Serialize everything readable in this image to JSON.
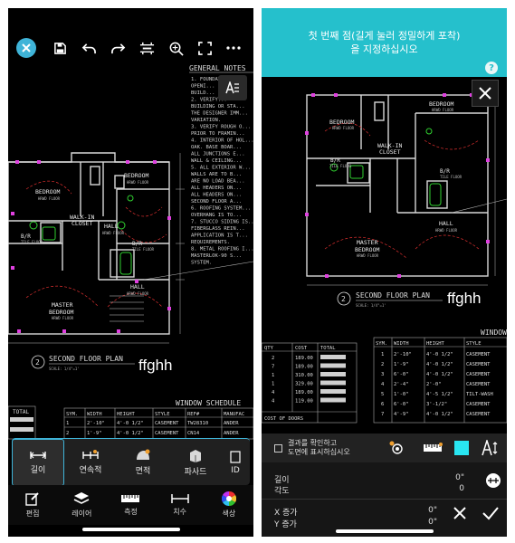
{
  "left": {
    "annotation_text": "ffghh",
    "notes_title": "GENERAL NOTES",
    "notes_lines": [
      "1. FOUNDATION...",
      "OPENI...",
      "BUILD...",
      "2. VERIFY...",
      "BUILDING OR STA...",
      "THE DESIGNER IMM...",
      "VARIATION.",
      "3. VERIFY ROUGH O...",
      "PRIOR TO FRAMIN...",
      "4. INTERIOR OF HOL...",
      "OAK. BASE BOAR...",
      "ALL JUNCTIONS E...",
      "WALL & CEILING...",
      "5. ALL EXTERIOR W...",
      "WALLS ARE TO B...",
      "ARE NO LOAD BEA...",
      "ALL HEADERS ON...",
      "ALL HEADERS ON...",
      "SECOND FLOOR A...",
      "6. ROOFING SYSTEM...",
      "OVERHANG IS TO...",
      "7. STUCCO SIDING IS...",
      "FIBERGLASS REIN...",
      "APPLICATION IS T...",
      "REQUIREMENTS.",
      "8. METAL ROOFING I...",
      "MASTERLOK-90 S...",
      "SYSTEM."
    ],
    "rooms": [
      {
        "name": "BEDROOM",
        "sub": "HRWD FLOOR"
      },
      {
        "name": "BEDROOM",
        "sub": "HRWD FLOOR"
      },
      {
        "name": "WALK-IN",
        "sub": "CLOSET"
      },
      {
        "name": "HALL",
        "sub": "HRWD FLOOR"
      },
      {
        "name": "B/R",
        "sub": "TILE FLOOR"
      },
      {
        "name": "B/R",
        "sub": "TILE FLOOR"
      },
      {
        "name": "HALL",
        "sub": "HRWD FLOOR"
      },
      {
        "name": "MASTER",
        "sub": "BEDROOM"
      },
      {
        "name": "HRWD FLOOR",
        "sub": ""
      }
    ],
    "plan_number": "2",
    "plan_title": "SECOND FLOOR PLAN",
    "plan_scale": "SCALE: 1/4\"=1'",
    "schedule_title": "WINDOW SCHEDULE",
    "schedule_headers": [
      "SYM.",
      "WIDTH",
      "HEIGHT",
      "STYLE",
      "REF#",
      "MANUFAC"
    ],
    "schedule_rows": [
      [
        "1",
        "2'-10\"",
        "4'-0 1/2\"",
        "CASEMENT",
        "TW28310",
        "ANDER"
      ],
      [
        "2",
        "1'-9\"",
        "4'-0 1/2\"",
        "CASEMENT",
        "CN14",
        "ANDER"
      ]
    ],
    "total_label": "TOTAL",
    "toolbar": {
      "close_icon": "close-icon",
      "save_icon": "save-icon",
      "undo_icon": "undo-icon",
      "redo_icon": "redo-icon",
      "crop_icon": "crop-icon",
      "zoom_icon": "zoom-icon",
      "fit_icon": "fullscreen-icon",
      "more_icon": "more-icon"
    },
    "measure_tools": [
      {
        "label": "길이",
        "icon": "length-icon",
        "active": true
      },
      {
        "label": "연속적",
        "icon": "continuous-icon",
        "active": false
      },
      {
        "label": "면적",
        "icon": "area-icon",
        "active": false
      },
      {
        "label": "파사드",
        "icon": "facade-icon",
        "active": false
      },
      {
        "label": "ID",
        "icon": "id-icon",
        "active": false
      }
    ],
    "nav": [
      {
        "label": "편집",
        "icon": "edit-icon"
      },
      {
        "label": "레이어",
        "icon": "layers-icon"
      },
      {
        "label": "측정",
        "icon": "measure-icon"
      },
      {
        "label": "치수",
        "icon": "dimension-icon"
      },
      {
        "label": "색상",
        "icon": "color-wheel-icon"
      }
    ]
  },
  "right": {
    "banner_line1": "첫 번째 점(길게 눌러 정밀하게 포착)",
    "banner_line2": "을 지정하십시오",
    "help_label": "?",
    "annotation_text": "ffghh",
    "checkbox_label_line1": "결과를 확인하고",
    "checkbox_label_line2": "도면에 표시하십시오",
    "length_label": "길이",
    "length_value": "0\"",
    "angle_label": "각도",
    "angle_value": "0",
    "x_label": "X 증가",
    "x_value": "0\"",
    "y_label": "Y 증가",
    "y_value": "0\"",
    "accent_color": "#29e6f2",
    "cost_headers": [
      "QTY",
      "COST",
      "TOTAL"
    ],
    "cost_rows": [
      [
        "2",
        "189.00"
      ],
      [
        "7",
        "189.00"
      ],
      [
        "1",
        "310.00"
      ],
      [
        "1",
        "329.00"
      ],
      [
        "4",
        "189.00"
      ],
      [
        "4",
        "119.00"
      ]
    ],
    "cost_footer": "COST OF DOORS",
    "window_title": "WINDOW",
    "window_headers": [
      "SYM.",
      "WIDTH",
      "HEIGHT",
      "STYLE"
    ],
    "window_rows": [
      [
        "1",
        "2'-10\"",
        "4'-0 1/2\"",
        "CASEMENT"
      ],
      [
        "2",
        "1'-9\"",
        "4'-0 1/2\"",
        "CASEMENT"
      ],
      [
        "3",
        "6'-0\"",
        "4'-0 1/2\"",
        "CASEMENT"
      ],
      [
        "4",
        "2'-4\"",
        "2'-0\"",
        "CASEMENT"
      ],
      [
        "5",
        "1'-0\"",
        "4'-5 1/2\"",
        "TILT-WASH"
      ],
      [
        "6",
        "6'-0\"",
        "3'-1/2\"",
        "CASEMENT"
      ],
      [
        "7",
        "4'-9\"",
        "4'-0 1/2\"",
        "CASEMENT"
      ]
    ],
    "plan_number": "2",
    "plan_title": "SECOND FLOOR PLAN",
    "plan_scale": "SCALE: 1/4\"=1'",
    "rooms": [
      {
        "name": "BEDROOM",
        "sub": "HRWD FLOOR"
      },
      {
        "name": "BEDROOM",
        "sub": "HRWD FLOOR"
      },
      {
        "name": "WALK-IN",
        "sub": "CLOSET"
      },
      {
        "name": "B/R",
        "sub": "TILE FLOOR"
      },
      {
        "name": "B/R",
        "sub": "TILE FLOOR"
      },
      {
        "name": "HALL",
        "sub": "HRWD FLOOR"
      },
      {
        "name": "MASTER",
        "sub": "BEDROOM"
      },
      {
        "name": "HRWD FLOOR",
        "sub": ""
      }
    ]
  }
}
